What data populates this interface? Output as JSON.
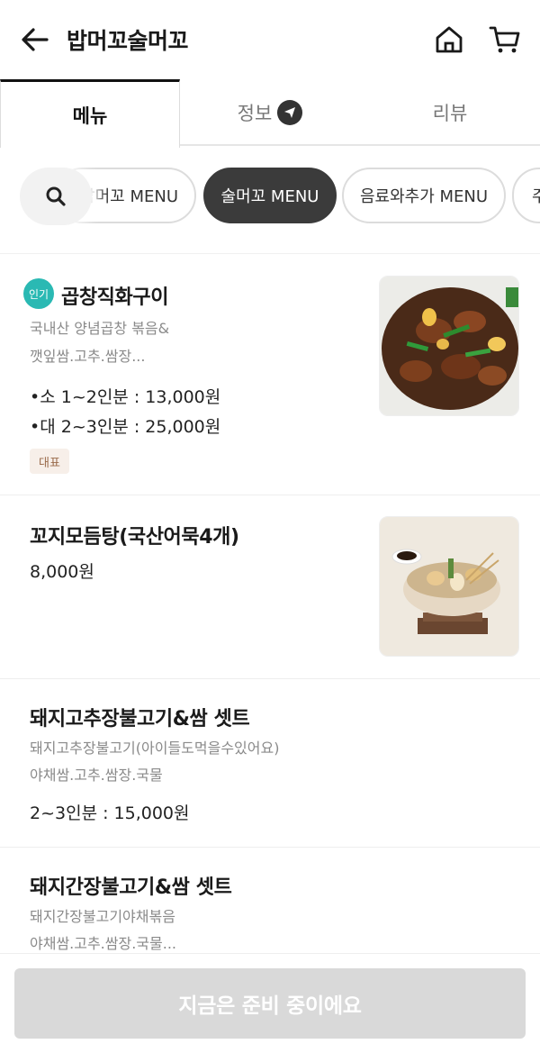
{
  "header": {
    "title": "밥머꼬술머꼬",
    "back_icon": "arrow-left-icon",
    "home_icon": "home-icon",
    "cart_icon": "cart-icon"
  },
  "tabs": [
    {
      "label": "메뉴",
      "active": true
    },
    {
      "label": "정보",
      "active": false
    },
    {
      "label": "리뷰",
      "active": false
    }
  ],
  "categories": [
    {
      "label": "밥머꼬 MENU",
      "active": false
    },
    {
      "label": "술머꼬 MENU",
      "active": true
    },
    {
      "label": "음료와추가 MENU",
      "active": false
    },
    {
      "label": "주",
      "active": false
    }
  ],
  "items": [
    {
      "badge": "인기",
      "name": "곱창직화구이",
      "desc1": "국내산 양념곱창 볶음&",
      "desc2": "깻잎쌈.고추.쌈장...",
      "price1": "•소 1~2인분 : 13,000원",
      "price2": "•대 2~3인분 : 25,000원",
      "tag": "대표"
    },
    {
      "name": "꼬지모듬탕(국산어묵4개)",
      "price1": "8,000원"
    },
    {
      "name": "돼지고추장불고기&쌈 셋트",
      "desc1": "돼지고추장불고기(아이들도먹을수있어요)",
      "desc2": "야채쌈.고추.쌈장.국물",
      "price1": "2~3인분 : 15,000원"
    },
    {
      "name": "돼지간장불고기&쌈 셋트",
      "desc1": "돼지간장불고기야채볶음",
      "desc2": "야채쌈.고추.쌈장.국물..."
    }
  ],
  "footer": {
    "cta_label": "지금은 준비 중이에요"
  },
  "colors": {
    "accent_active_chip": "#3b3b3b",
    "popular_badge": "#2ab9b3",
    "cta_disabled": "#d9d9d9"
  }
}
